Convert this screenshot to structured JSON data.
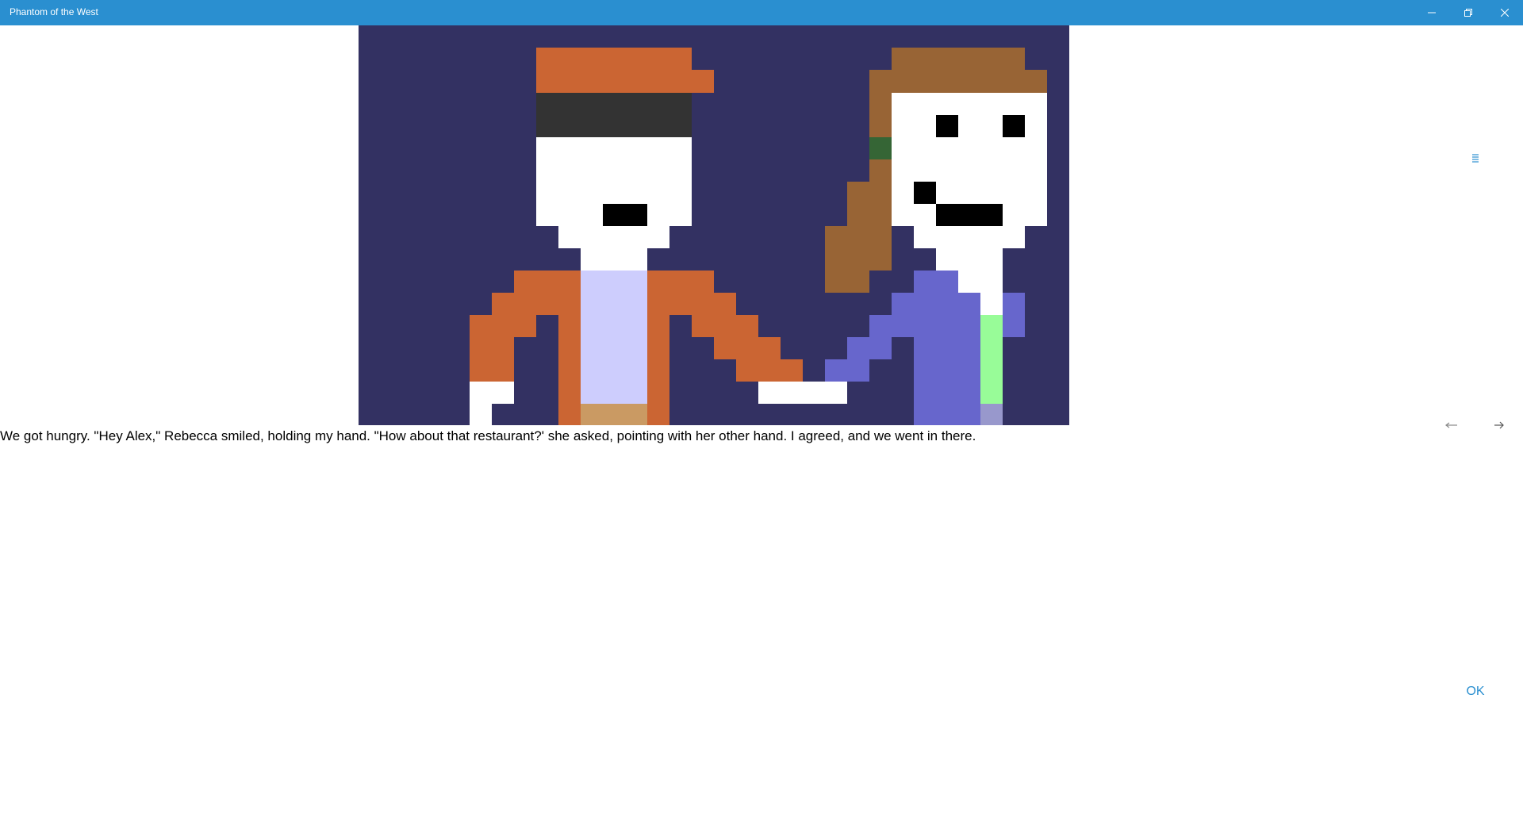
{
  "window": {
    "title": "Phantom of the West",
    "controls": {
      "minimize_icon": "minimize-icon",
      "restore_icon": "restore-icon",
      "close_icon": "close-icon"
    },
    "accent_color": "#2a8fd0"
  },
  "scene": {
    "background_color": "#333162",
    "characters": [
      "alex",
      "rebecca"
    ]
  },
  "story": {
    "text": "We got hungry. \"Hey Alex,\" Rebecca smiled, holding my hand. \"How about that restaurant?' she asked, pointing with her other hand. I agreed, and we went in there."
  },
  "controls": {
    "menu_icon": "menu-icon",
    "prev_icon": "arrow-left-icon",
    "next_icon": "arrow-right-icon",
    "ok_label": "OK"
  }
}
